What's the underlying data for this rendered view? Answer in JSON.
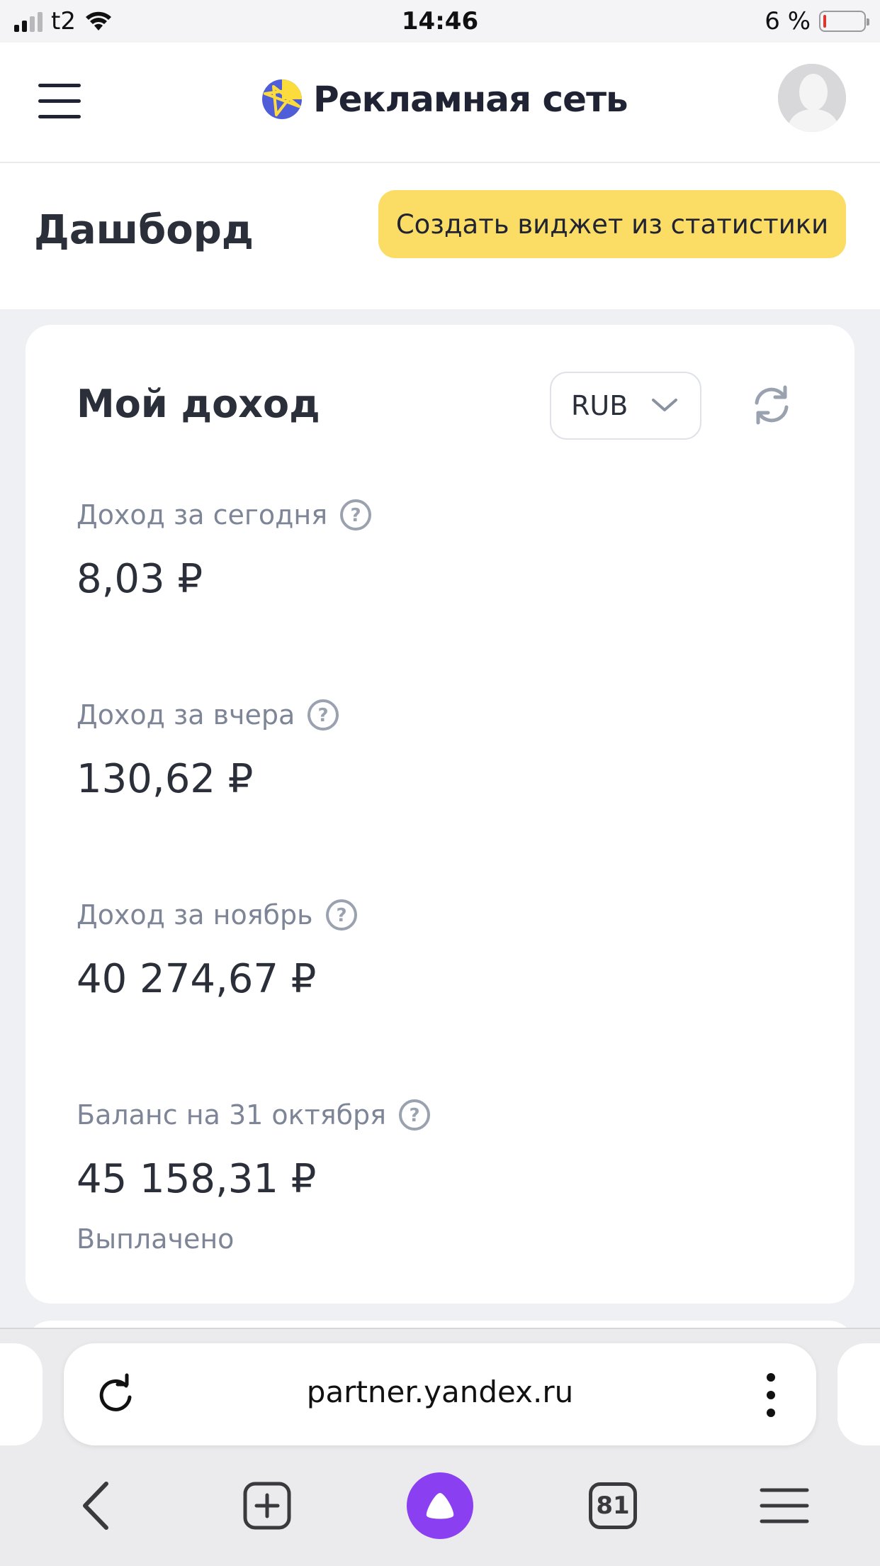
{
  "status_bar": {
    "carrier": "t2",
    "time": "14:46",
    "battery_percent": "6 %",
    "battery_level": 0.06
  },
  "header": {
    "brand_title": "Рекламная сеть",
    "menu_icon": "hamburger-menu-icon",
    "avatar_icon": "user-avatar"
  },
  "dashboard": {
    "title": "Дашборд",
    "create_widget_label": "Создать виджет из статистики"
  },
  "income_card": {
    "title": "Мой доход",
    "currency": "RUB",
    "metrics": [
      {
        "label": "Доход за сегодня",
        "value": "8,03 ₽"
      },
      {
        "label": "Доход за вчера",
        "value": "130,62 ₽"
      },
      {
        "label": "Доход за ноябрь",
        "value": "40 274,67 ₽"
      },
      {
        "label": "Баланс на 31 октября",
        "value": "45 158,31 ₽",
        "note": "Выплачено"
      }
    ]
  },
  "browser": {
    "url": "partner.yandex.ru",
    "tab_count": "81"
  },
  "colors": {
    "accent_yellow": "#fbdc64",
    "alice_purple": "#8a3ff0",
    "page_bg": "#eef0f4",
    "text_muted": "#7d8597"
  }
}
